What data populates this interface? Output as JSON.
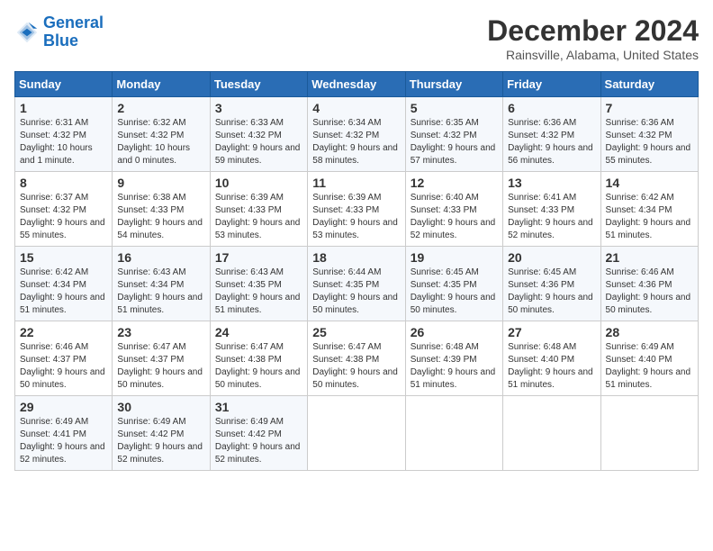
{
  "logo": {
    "line1": "General",
    "line2": "Blue"
  },
  "title": "December 2024",
  "location": "Rainsville, Alabama, United States",
  "days_of_week": [
    "Sunday",
    "Monday",
    "Tuesday",
    "Wednesday",
    "Thursday",
    "Friday",
    "Saturday"
  ],
  "weeks": [
    [
      {
        "day": "1",
        "sunrise": "6:31 AM",
        "sunset": "4:32 PM",
        "daylight": "10 hours and 1 minute."
      },
      {
        "day": "2",
        "sunrise": "6:32 AM",
        "sunset": "4:32 PM",
        "daylight": "10 hours and 0 minutes."
      },
      {
        "day": "3",
        "sunrise": "6:33 AM",
        "sunset": "4:32 PM",
        "daylight": "9 hours and 59 minutes."
      },
      {
        "day": "4",
        "sunrise": "6:34 AM",
        "sunset": "4:32 PM",
        "daylight": "9 hours and 58 minutes."
      },
      {
        "day": "5",
        "sunrise": "6:35 AM",
        "sunset": "4:32 PM",
        "daylight": "9 hours and 57 minutes."
      },
      {
        "day": "6",
        "sunrise": "6:36 AM",
        "sunset": "4:32 PM",
        "daylight": "9 hours and 56 minutes."
      },
      {
        "day": "7",
        "sunrise": "6:36 AM",
        "sunset": "4:32 PM",
        "daylight": "9 hours and 55 minutes."
      }
    ],
    [
      {
        "day": "8",
        "sunrise": "6:37 AM",
        "sunset": "4:32 PM",
        "daylight": "9 hours and 55 minutes."
      },
      {
        "day": "9",
        "sunrise": "6:38 AM",
        "sunset": "4:33 PM",
        "daylight": "9 hours and 54 minutes."
      },
      {
        "day": "10",
        "sunrise": "6:39 AM",
        "sunset": "4:33 PM",
        "daylight": "9 hours and 53 minutes."
      },
      {
        "day": "11",
        "sunrise": "6:39 AM",
        "sunset": "4:33 PM",
        "daylight": "9 hours and 53 minutes."
      },
      {
        "day": "12",
        "sunrise": "6:40 AM",
        "sunset": "4:33 PM",
        "daylight": "9 hours and 52 minutes."
      },
      {
        "day": "13",
        "sunrise": "6:41 AM",
        "sunset": "4:33 PM",
        "daylight": "9 hours and 52 minutes."
      },
      {
        "day": "14",
        "sunrise": "6:42 AM",
        "sunset": "4:34 PM",
        "daylight": "9 hours and 51 minutes."
      }
    ],
    [
      {
        "day": "15",
        "sunrise": "6:42 AM",
        "sunset": "4:34 PM",
        "daylight": "9 hours and 51 minutes."
      },
      {
        "day": "16",
        "sunrise": "6:43 AM",
        "sunset": "4:34 PM",
        "daylight": "9 hours and 51 minutes."
      },
      {
        "day": "17",
        "sunrise": "6:43 AM",
        "sunset": "4:35 PM",
        "daylight": "9 hours and 51 minutes."
      },
      {
        "day": "18",
        "sunrise": "6:44 AM",
        "sunset": "4:35 PM",
        "daylight": "9 hours and 50 minutes."
      },
      {
        "day": "19",
        "sunrise": "6:45 AM",
        "sunset": "4:35 PM",
        "daylight": "9 hours and 50 minutes."
      },
      {
        "day": "20",
        "sunrise": "6:45 AM",
        "sunset": "4:36 PM",
        "daylight": "9 hours and 50 minutes."
      },
      {
        "day": "21",
        "sunrise": "6:46 AM",
        "sunset": "4:36 PM",
        "daylight": "9 hours and 50 minutes."
      }
    ],
    [
      {
        "day": "22",
        "sunrise": "6:46 AM",
        "sunset": "4:37 PM",
        "daylight": "9 hours and 50 minutes."
      },
      {
        "day": "23",
        "sunrise": "6:47 AM",
        "sunset": "4:37 PM",
        "daylight": "9 hours and 50 minutes."
      },
      {
        "day": "24",
        "sunrise": "6:47 AM",
        "sunset": "4:38 PM",
        "daylight": "9 hours and 50 minutes."
      },
      {
        "day": "25",
        "sunrise": "6:47 AM",
        "sunset": "4:38 PM",
        "daylight": "9 hours and 50 minutes."
      },
      {
        "day": "26",
        "sunrise": "6:48 AM",
        "sunset": "4:39 PM",
        "daylight": "9 hours and 51 minutes."
      },
      {
        "day": "27",
        "sunrise": "6:48 AM",
        "sunset": "4:40 PM",
        "daylight": "9 hours and 51 minutes."
      },
      {
        "day": "28",
        "sunrise": "6:49 AM",
        "sunset": "4:40 PM",
        "daylight": "9 hours and 51 minutes."
      }
    ],
    [
      {
        "day": "29",
        "sunrise": "6:49 AM",
        "sunset": "4:41 PM",
        "daylight": "9 hours and 52 minutes."
      },
      {
        "day": "30",
        "sunrise": "6:49 AM",
        "sunset": "4:42 PM",
        "daylight": "9 hours and 52 minutes."
      },
      {
        "day": "31",
        "sunrise": "6:49 AM",
        "sunset": "4:42 PM",
        "daylight": "9 hours and 52 minutes."
      },
      null,
      null,
      null,
      null
    ]
  ],
  "labels": {
    "sunrise": "Sunrise:",
    "sunset": "Sunset:",
    "daylight": "Daylight:"
  }
}
